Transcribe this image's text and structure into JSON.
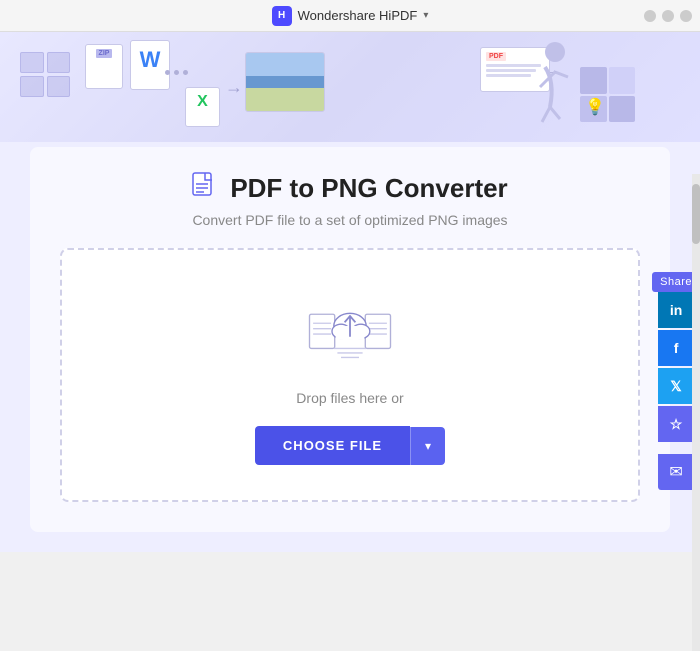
{
  "titlebar": {
    "app_name": "Wondershare HiPDF",
    "chevron": "▾"
  },
  "banner": {
    "zip_label": "ZIP",
    "word_letter": "W",
    "excel_letter": "X",
    "pdf_label": "PDF"
  },
  "converter": {
    "title": "PDF to PNG Converter",
    "subtitle": "Convert PDF file to a set of optimized PNG images",
    "drop_label": "Drop files here or",
    "choose_file_btn": "CHOOSE FILE",
    "dropdown_arrow": "▾"
  },
  "share_panel": {
    "label": "Share",
    "linkedin": "in",
    "facebook": "f",
    "twitter": "𝕏",
    "star": "☆",
    "email": "✉"
  }
}
